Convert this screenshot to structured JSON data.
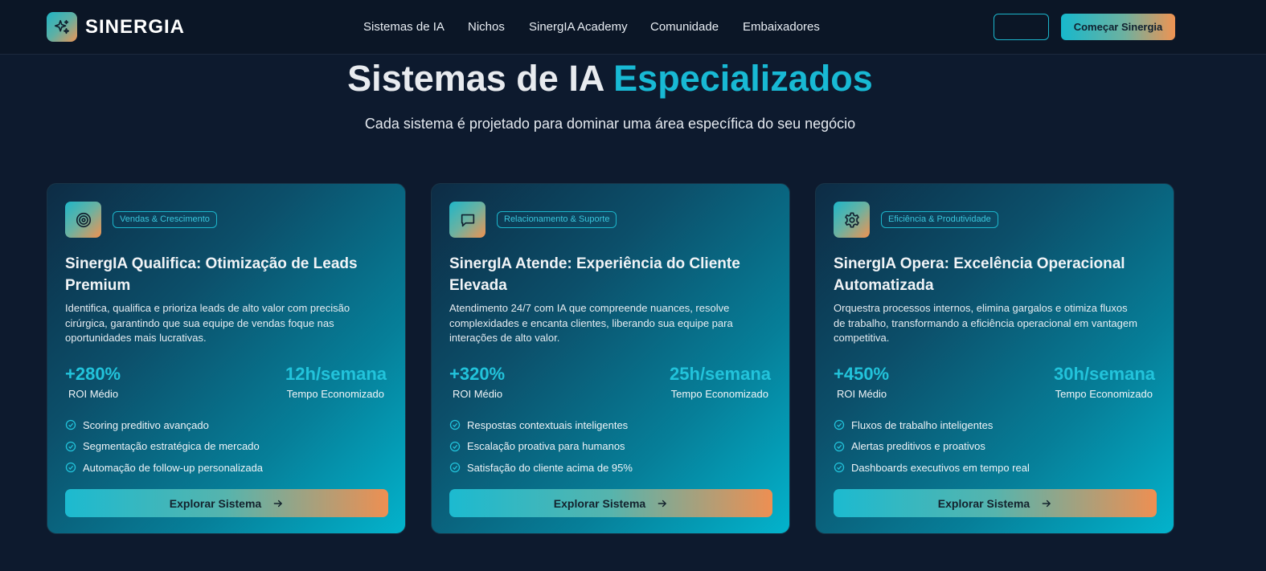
{
  "brand": {
    "name": "SINERGIA",
    "logo_icon": "sparkles-icon"
  },
  "nav": {
    "links": [
      {
        "label": "Sistemas de IA"
      },
      {
        "label": "Nichos"
      },
      {
        "label": "SinergIA Academy"
      },
      {
        "label": "Comunidade"
      },
      {
        "label": "Embaixadores"
      }
    ],
    "login_label": "",
    "cta_label": "Começar Sinergia"
  },
  "hero": {
    "title_main": "Sistemas de IA",
    "title_accent": "Especializados",
    "subtitle": "Cada sistema é projetado para dominar uma área específica do seu negócio"
  },
  "colors": {
    "background": "#0d1a2e",
    "accent": "#18b9d4",
    "gradient_end": "#ef9352"
  },
  "cards": [
    {
      "icon": "target-icon",
      "badge": "Vendas & Crescimento",
      "title": "SinergIA Qualifica: Otimização de Leads Premium",
      "description": "Identifica, qualifica e prioriza leads de alto valor com precisão cirúrgica, garantindo que sua equipe de vendas foque nas oportunidades mais lucrativas.",
      "stat1_value": "+280%",
      "stat1_label": "ROI Médio",
      "stat2_value": "12h/semana",
      "stat2_label": "Tempo Economizado",
      "features": [
        "Scoring preditivo avançado",
        "Segmentação estratégica de mercado",
        "Automação de follow-up personalizada"
      ],
      "button": "Explorar Sistema"
    },
    {
      "icon": "chat-bubble-icon",
      "badge": "Relacionamento & Suporte",
      "title": "SinergIA Atende: Experiência do Cliente Elevada",
      "description": "Atendimento 24/7 com IA que compreende nuances, resolve complexidades e encanta clientes, liberando sua equipe para interações de alto valor.",
      "stat1_value": "+320%",
      "stat1_label": "ROI Médio",
      "stat2_value": "25h/semana",
      "stat2_label": "Tempo Economizado",
      "features": [
        "Respostas contextuais inteligentes",
        "Escalação proativa para humanos",
        "Satisfação do cliente acima de 95%"
      ],
      "button": "Explorar Sistema"
    },
    {
      "icon": "gear-icon",
      "badge": "Eficiência & Produtividade",
      "title": "SinergIA Opera: Excelência Operacional Automatizada",
      "description": "Orquestra processos internos, elimina gargalos e otimiza fluxos de trabalho, transformando a eficiência operacional em vantagem competitiva.",
      "stat1_value": "+450%",
      "stat1_label": "ROI Médio",
      "stat2_value": "30h/semana",
      "stat2_label": "Tempo Economizado",
      "features": [
        "Fluxos de trabalho inteligentes",
        "Alertas preditivos e proativos",
        "Dashboards executivos em tempo real"
      ],
      "button": "Explorar Sistema"
    }
  ]
}
